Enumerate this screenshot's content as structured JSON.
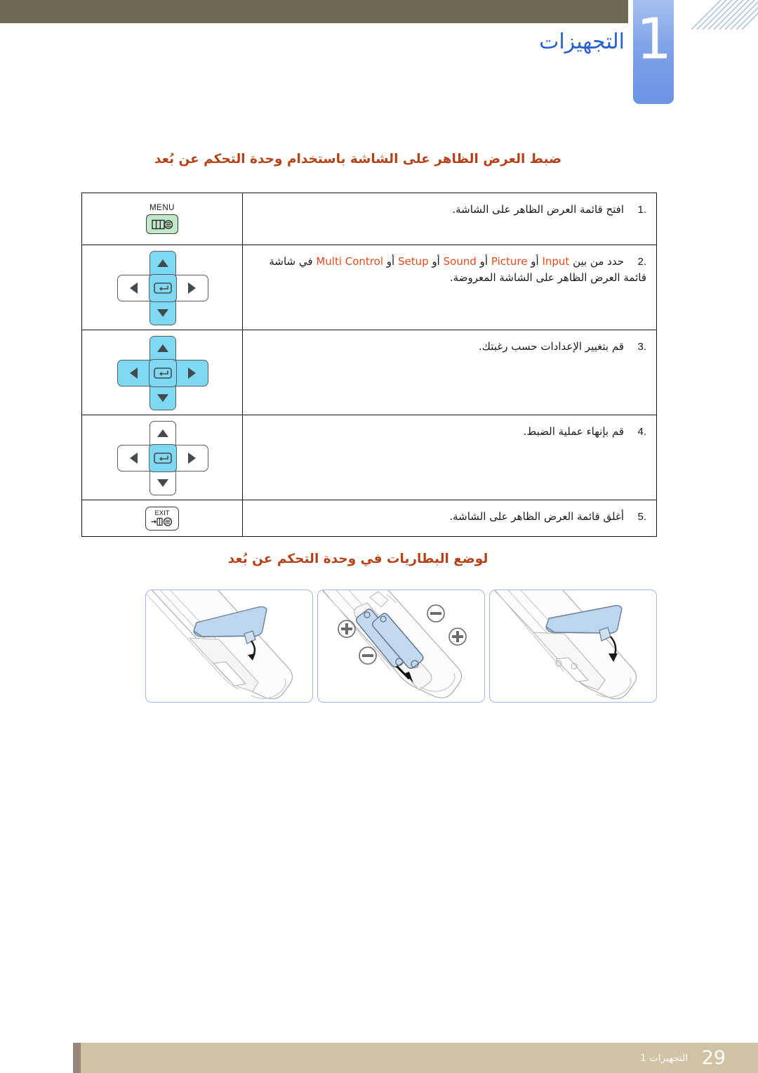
{
  "header": {
    "chapter_number": "1",
    "chapter_title": "التجهيزات"
  },
  "sections": {
    "osd_heading": "ضبط العرض الظاهر على الشاشة باستخدام وحدة التحكم عن بُعد",
    "battery_heading": "لوضع البطاريات في وحدة التحكم عن بُعد"
  },
  "steps": [
    {
      "number": "1.",
      "text": "افتح قائمة العرض الظاهر على الشاشة.",
      "button_label": "MENU",
      "button_icon": "menu-icon"
    },
    {
      "number": "2.",
      "text_before": "حدد من بين",
      "options": [
        "Input",
        "Picture",
        "Sound",
        "Setup",
        "Multi Control"
      ],
      "separator": "أو",
      "text_after": "في شاشة قائمة العرض الظاهر على الشاشة المعروضة.",
      "button_icon": "dpad-up-down-enter"
    },
    {
      "number": "3.",
      "text": "قم بتغيير الإعدادات حسب رغبتك.",
      "button_icon": "dpad-all"
    },
    {
      "number": "4.",
      "text": "قم بإنهاء عملية الضبط.",
      "button_icon": "dpad-enter"
    },
    {
      "number": "5.",
      "text": "أغلق قائمة العرض الظاهر على الشاشة.",
      "button_label": "EXIT",
      "button_icon": "exit-icon"
    }
  ],
  "battery_panels": [
    {
      "name": "open-battery-cover",
      "polarity": []
    },
    {
      "name": "insert-batteries",
      "polarity": [
        "+",
        "−",
        "−",
        "+"
      ]
    },
    {
      "name": "close-battery-cover",
      "polarity": []
    }
  ],
  "footer": {
    "page_number": "29",
    "chapter_label": "التجهيزات 1"
  },
  "colors": {
    "header_bar": "#6f6a55",
    "chapter_tab": "#7fa3e8",
    "chapter_title": "#2a5fd0",
    "heading": "#b5431a",
    "highlight": "#e8491d",
    "menu_key": "#bfe9c9",
    "dpad_active": "#7fd9f2",
    "panel_border": "#9fb6e8",
    "footer_band": "#d0c3a4",
    "footer_tab": "#958779"
  }
}
